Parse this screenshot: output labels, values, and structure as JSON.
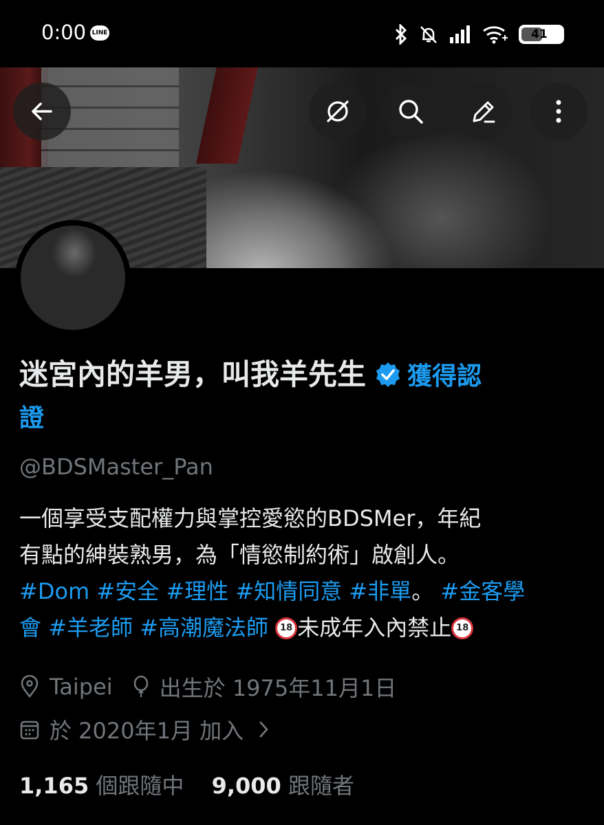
{
  "status_bar": {
    "time": "0:00",
    "line_badge": "LINE",
    "battery": "41"
  },
  "profile": {
    "name": "迷宮內的羊男，叫我羊先生",
    "verified_label_line1": "獲得認",
    "verified_label_line2": "證",
    "handle": "@BDSMaster_Pan",
    "bio": {
      "line1": "一個享受支配權力與掌控愛慾的BDSMer，年紀",
      "line2": "有點的紳裝熟男，為「情慾制約術」啟創人。",
      "tag_dom": "#Dom",
      "tag_safe": "#安全",
      "tag_rational": "#理性",
      "tag_consent": "#知情同意",
      "tag_nonsingle": "#非單",
      "sep": "。",
      "tag_jinke_1": "#金客學",
      "tag_jinke_2": "會",
      "tag_teacher": "#羊老師",
      "tag_mage": "#高潮魔法師",
      "under18_badge": "18",
      "no_minors": "未成年入內禁止"
    },
    "location": "Taipei",
    "birthday": "出生於 1975年11月1日",
    "joined": "於 2020年1月 加入",
    "following_count": "1,165",
    "following_label": "個跟隨中",
    "followers_count": "9,000",
    "followers_label": "跟隨者"
  },
  "colors": {
    "accent": "#1d9bf0",
    "text": "#e7e9ea",
    "muted": "#71767b",
    "background": "#000000"
  }
}
